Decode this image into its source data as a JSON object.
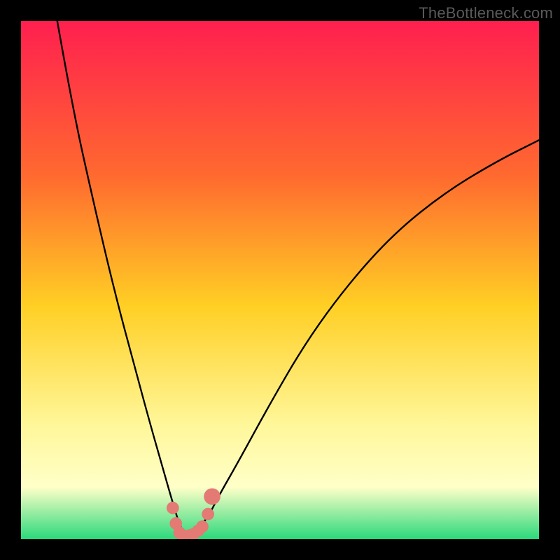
{
  "attribution": "TheBottleneck.com",
  "colors": {
    "frame": "#000000",
    "grad_top": "#ff1f4f",
    "grad_q1": "#ff6a2f",
    "grad_mid": "#ffcf24",
    "grad_q3": "#fff79a",
    "grad_band": "#ffffc8",
    "grad_bottom": "#2bd97b",
    "curve": "#000000",
    "marker": "#e37a74"
  },
  "chart_data": {
    "type": "line",
    "title": "",
    "xlabel": "",
    "ylabel": "",
    "xlim": [
      0,
      100
    ],
    "ylim": [
      0,
      100
    ],
    "grid": false,
    "legend": false,
    "series": [
      {
        "name": "bottleneck-curve",
        "x": [
          7,
          10,
          14,
          18,
          22,
          25,
          27,
          29,
          30.5,
          31.5,
          32.5,
          34,
          36,
          38,
          42,
          48,
          55,
          63,
          72,
          82,
          92,
          100
        ],
        "y": [
          100,
          83,
          65,
          48,
          33,
          22,
          15,
          8,
          3,
          1,
          1,
          2,
          4,
          8,
          15,
          26,
          38,
          49,
          59,
          67,
          73,
          77
        ]
      }
    ],
    "markers": {
      "name": "highlight-points",
      "x": [
        29.3,
        29.9,
        30.6,
        31.4,
        32.3,
        33.2,
        34.2,
        35.0,
        36.1,
        36.9
      ],
      "y": [
        6.0,
        3.0,
        1.2,
        0.6,
        0.6,
        0.9,
        1.6,
        2.4,
        4.8,
        8.2
      ],
      "r": [
        1.2,
        1.2,
        1.2,
        1.2,
        1.2,
        1.2,
        1.2,
        1.2,
        1.2,
        1.6
      ]
    }
  }
}
